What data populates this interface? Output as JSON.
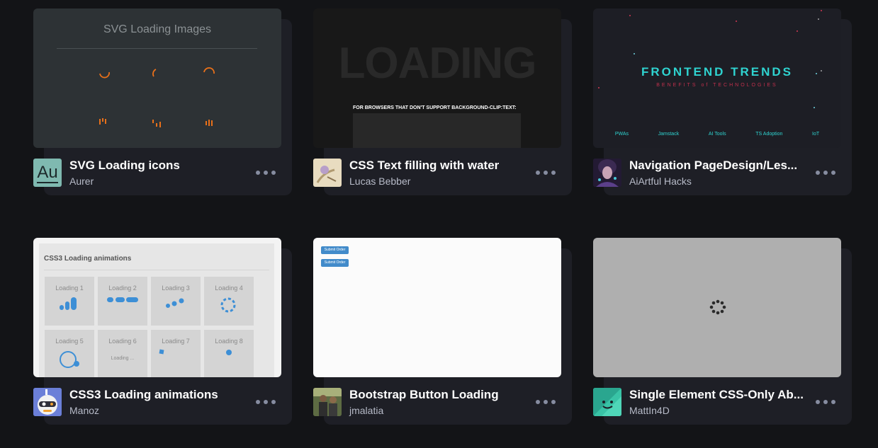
{
  "pens": [
    {
      "title": "SVG Loading icons",
      "author": "Aurer",
      "avatar_text": "Au",
      "preview": {
        "heading": "SVG Loading Images"
      }
    },
    {
      "title": "CSS Text filling with water",
      "author": "Lucas Bebber",
      "preview": {
        "big_text": "LOADING",
        "note": "FOR BROWSERS THAT DON'T SUPPORT BACKGROUND-CLIP:TEXT:"
      }
    },
    {
      "title": "Navigation PageDesign/Les...",
      "author": "AiArtful Hacks",
      "preview": {
        "heading": "FRONTEND TRENDS",
        "subheading": "BENEFITS of TECHNOLOGIES",
        "nav": [
          "PWAs",
          "Jamstack",
          "AI Tools",
          "TS Adoption",
          "IoT"
        ]
      }
    },
    {
      "title": "CSS3 Loading animations",
      "author": "Manoz",
      "preview": {
        "heading": "CSS3 Loading animations",
        "tiles": [
          "Loading 1",
          "Loading 2",
          "Loading 3",
          "Loading 4",
          "Loading 5",
          "Loading 6",
          "Loading 7",
          "Loading 8"
        ],
        "loading_text": "Loading ..."
      }
    },
    {
      "title": "Bootstrap Button Loading",
      "author": "jmalatia",
      "preview": {
        "buttons": [
          "Submit Order",
          "Submit Order"
        ]
      }
    },
    {
      "title": "Single Element CSS-Only Ab...",
      "author": "MattIn4D",
      "preview": {}
    }
  ],
  "colors": {
    "page_bg": "#131417",
    "card_bg": "#1e1f26",
    "accent_orange": "#e8701a",
    "accent_teal": "#2fd3d0",
    "accent_blue": "#3d8fd6"
  }
}
